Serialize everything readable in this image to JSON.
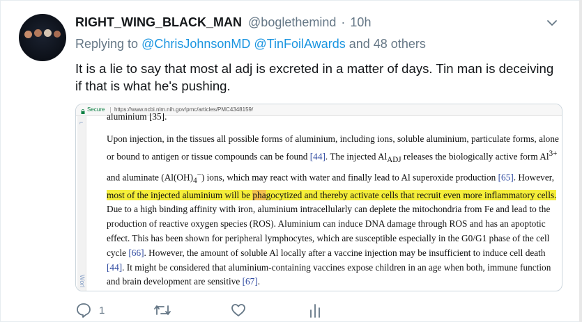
{
  "tweet": {
    "display_name": "RIGHT_WING_BLACK_MAN",
    "handle": "@boglethemind",
    "separator": "·",
    "time": "10h",
    "replying_prefix": "Replying to",
    "mention_1": "@ChrisJohnsonMD",
    "mention_2": "@TinFoilAwards",
    "replying_suffix": "and 48 others",
    "text": "It is a lie to say that most al adj is excreted in a matter of days.   Tin man is deceiving if that is what he's pushing."
  },
  "embedded_screenshot": {
    "secure_label": "Secure",
    "url": "https://www.ncbi.nlm.nih.gov/pmc/articles/PMC4348159/",
    "cut_top_text": "aluminium [35].",
    "rail_text": "Worl",
    "paragraph": {
      "p1": "Upon injection, in the tissues all possible forms of aluminium, including ions, soluble aluminium, particulate forms, alone or bound to antigen or tissue compounds can be found ",
      "ref44a": "[44]",
      "p2": ". The injected Al",
      "sub_adj": "ADJ",
      "p3": " releases the biologically active form Al",
      "sup_3plus": "3+",
      "p4": " and aluminate (Al(OH)",
      "sub_4": "4",
      "sup_minus": "−",
      "p5": ") ions, which may react with water and finally lead to Al superoxide production ",
      "ref65": "[65]",
      "p6": ". However, ",
      "highlight_1": "most of the injected aluminium will be ",
      "highlight_orange": "pha",
      "highlight_2": "gocytized and thereby activate cells that recruit even more inflammatory cells.",
      "p7": " Due to a high binding affinity with iron, aluminium intracellularly can deplete the mitochondria from Fe and lead to the production of reactive oxygen species (ROS). Aluminium can induce DNA damage through ROS and has an apoptotic effect. This has been shown for peripheral lymphocytes, which are susceptible especially in the G0/G1 phase of the cell cycle ",
      "ref66": "[66]",
      "p8": ". However, the amount of soluble Al locally after a vaccine injection may be insufficient to induce cell death ",
      "ref44b": "[44]",
      "p9": ". It might be considered that aluminium-containing vaccines expose children in an age when both, immune function and brain development are sensitive ",
      "ref67": "[67]",
      "p10": "."
    }
  },
  "actions": {
    "reply_count": "1",
    "icons": [
      "reply-icon",
      "retweet-icon",
      "like-icon",
      "analytics-icon"
    ]
  },
  "colors": {
    "link": "#1b95e0",
    "muted": "#657786",
    "highlight": "#f5ee3a"
  }
}
